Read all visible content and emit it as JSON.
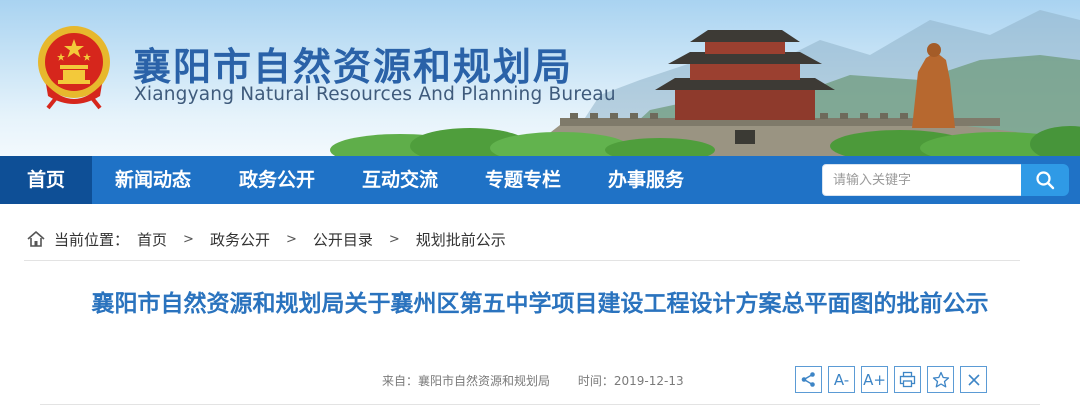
{
  "header": {
    "title": "襄阳市自然资源和规划局",
    "subtitle": "Xiangyang Natural Resources And Planning Bureau"
  },
  "nav": {
    "items": [
      {
        "label": "首页",
        "active": true
      },
      {
        "label": "新闻动态"
      },
      {
        "label": "政务公开"
      },
      {
        "label": "互动交流"
      },
      {
        "label": "专题专栏"
      },
      {
        "label": "办事服务"
      }
    ],
    "search_placeholder": "请输入关键字"
  },
  "breadcrumb": {
    "prefix": "当前位置：",
    "items": [
      "首页",
      "政务公开",
      "公开目录",
      "规划批前公示"
    ],
    "separator": ">"
  },
  "article": {
    "title": "襄阳市自然资源和规划局关于襄州区第五中学项目建设工程设计方案总平面图的批前公示",
    "source": "来自：襄阳市自然资源和规划局",
    "time": "时间：2019-12-13"
  },
  "toolbar": {
    "icons": [
      "share-icon",
      "font-decrease-icon",
      "font-increase-icon",
      "print-icon",
      "favorite-icon",
      "close-icon"
    ],
    "font_minus_label": "A-",
    "font_plus_label": "A+"
  },
  "colors": {
    "nav_bg": "#1f72c6",
    "nav_active": "#0e4f96",
    "title_blue": "#2a73be",
    "search_button": "#2f9ae6"
  }
}
